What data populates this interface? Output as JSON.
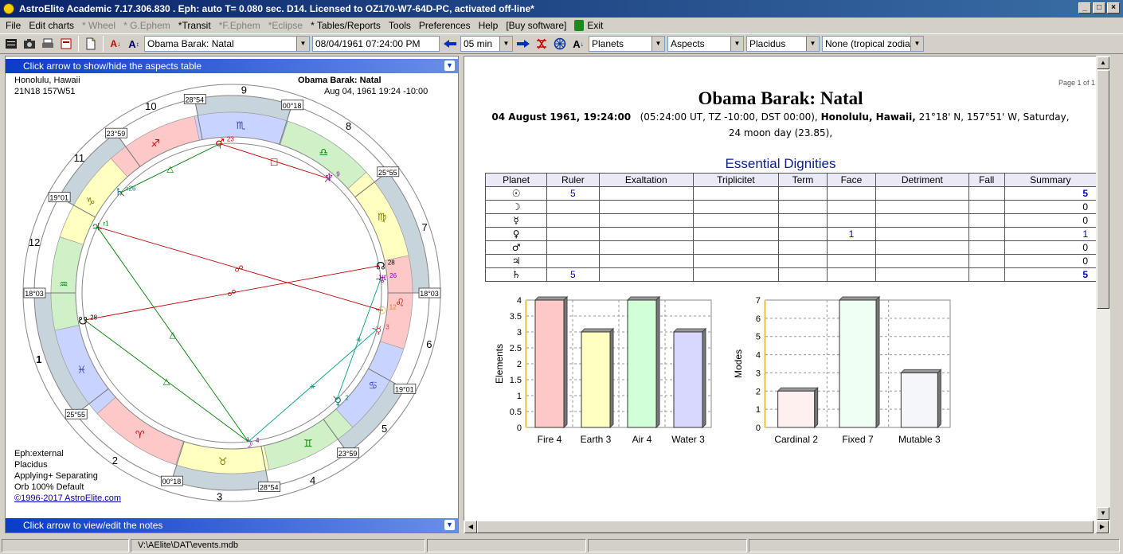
{
  "window": {
    "title": "AstroElite Academic 7.17.306.830 . Eph: auto T= 0.080 sec. D14. Licensed to OZ170-W7-64D-PC, activated off-line*",
    "buttons": [
      "_",
      "□",
      "×"
    ]
  },
  "menu": [
    {
      "label": "File",
      "disabled": false
    },
    {
      "label": "Edit charts",
      "disabled": false
    },
    {
      "label": "* Wheel",
      "disabled": true
    },
    {
      "label": "* G.Ephem",
      "disabled": true
    },
    {
      "label": "*Transit",
      "disabled": false
    },
    {
      "label": "*F.Ephem",
      "disabled": true
    },
    {
      "label": "*Eclipse",
      "disabled": true
    },
    {
      "label": "* Tables/Reports",
      "disabled": false
    },
    {
      "label": "Tools",
      "disabled": false
    },
    {
      "label": "Preferences",
      "disabled": false
    },
    {
      "label": "Help",
      "disabled": false
    },
    {
      "label": "[Buy software]",
      "disabled": false
    },
    {
      "label": "Exit",
      "disabled": false
    }
  ],
  "toolbar": {
    "chart_name": "Obama Barak: Natal",
    "datetime": "08/04/1961   07:24:00 PM",
    "step": "05 min",
    "planets": "Planets",
    "aspects": "Aspects",
    "house_system": "Placidus",
    "zodiac": "None (tropical zodiac)",
    "letter_a": "A",
    "arrow": "↓"
  },
  "left": {
    "top_bar": "Click arrow to show/hide the aspects table",
    "bottom_bar": "Click arrow to view/edit the notes",
    "location": "Honolulu, Hawaii",
    "coords": "21N18 157W51",
    "chart_title": "Obama Barak: Natal",
    "chart_date": "Aug 04, 1961 19:24 -10:00",
    "info": [
      "Eph:external",
      "Placidus",
      "Applying+ Separating",
      "Orb 100% Default"
    ],
    "copyright": "©1996-2017 AstroElite.com",
    "house_numbers": [
      "1",
      "2",
      "3",
      "4",
      "5",
      "6",
      "7",
      "8",
      "9",
      "10",
      "11",
      "12"
    ],
    "cusp_labels": [
      "18°03",
      "25°55",
      "00°18",
      "28°54",
      "23°59",
      "19°01",
      "18°03",
      "25°55",
      "00°18",
      "28°54",
      "23°59",
      "19°01"
    ],
    "signs": [
      "♓",
      "♈",
      "♉",
      "♊",
      "♋",
      "♌",
      "♍",
      "♎",
      "♏",
      "♐",
      "♑",
      "♒"
    ],
    "planets": [
      {
        "glyph": "♆",
        "deg": "9",
        "color": "#a000a0"
      },
      {
        "glyph": "♂",
        "deg": "23",
        "color": "#d00000"
      },
      {
        "glyph": "☊",
        "deg": "28",
        "color": "#000000"
      },
      {
        "glyph": "♅",
        "deg": "26",
        "color": "#a000a0"
      },
      {
        "glyph": "☉",
        "deg": "12",
        "color": "#e08000"
      },
      {
        "glyph": "☿",
        "deg": "3",
        "color": "#e04060"
      },
      {
        "glyph": "♀",
        "deg": "2",
        "color": "#008080"
      },
      {
        "glyph": "☽",
        "deg": "4",
        "color": "#8000a0"
      },
      {
        "glyph": "☋",
        "deg": "28",
        "color": "#000000"
      },
      {
        "glyph": "♃",
        "deg": "r1",
        "color": "#008000"
      },
      {
        "glyph": "♄",
        "deg": "r26",
        "color": "#008080"
      }
    ]
  },
  "report": {
    "page": "Page 1 of 1",
    "title": "Obama Barak: Natal",
    "date_bold": "04 August 1961, 19:24:00",
    "date_detail": "(05:24:00 UT, TZ -10:00, DST  00:00),",
    "place_bold": "Honolulu, Hawaii,",
    "place_detail": "21°18' N, 157°51' W, Saturday,",
    "moon_day": "24 moon day (23.85),",
    "section": "Essential Dignities",
    "columns": [
      "Planet",
      "Ruler",
      "Exaltation",
      "Triplicitet",
      "Term",
      "Face",
      "Detriment",
      "Fall",
      "Summary"
    ],
    "rows": [
      {
        "planet": "☉",
        "ruler": "5",
        "exaltation": "",
        "triplicitet": "",
        "term": "",
        "face": "",
        "detriment": "",
        "fall": "",
        "summary": "5",
        "bold": true
      },
      {
        "planet": "☽",
        "ruler": "",
        "exaltation": "",
        "triplicitet": "",
        "term": "",
        "face": "",
        "detriment": "",
        "fall": "",
        "summary": "0",
        "bold": false
      },
      {
        "planet": "☿",
        "ruler": "",
        "exaltation": "",
        "triplicitet": "",
        "term": "",
        "face": "",
        "detriment": "",
        "fall": "",
        "summary": "0",
        "bold": false
      },
      {
        "planet": "♀",
        "ruler": "",
        "exaltation": "",
        "triplicitet": "",
        "term": "",
        "face": "1",
        "detriment": "",
        "fall": "",
        "summary": "1",
        "bold": false
      },
      {
        "planet": "♂",
        "ruler": "",
        "exaltation": "",
        "triplicitet": "",
        "term": "",
        "face": "",
        "detriment": "",
        "fall": "",
        "summary": "0",
        "bold": false
      },
      {
        "planet": "♃",
        "ruler": "",
        "exaltation": "",
        "triplicitet": "",
        "term": "",
        "face": "",
        "detriment": "",
        "fall": "",
        "summary": "0",
        "bold": false
      },
      {
        "planet": "♄",
        "ruler": "5",
        "exaltation": "",
        "triplicitet": "",
        "term": "",
        "face": "",
        "detriment": "",
        "fall": "",
        "summary": "5",
        "bold": true
      }
    ]
  },
  "status": {
    "path": "V:\\AElite\\DAT\\events.mdb"
  },
  "chart_data": [
    {
      "type": "bar",
      "ylabel": "Elements",
      "categories": [
        "Fire 4",
        "Earth 3",
        "Air 4",
        "Water 3"
      ],
      "values": [
        4,
        3,
        4,
        3
      ],
      "colors": [
        "#ffc8c8",
        "#ffffc0",
        "#d0ffd8",
        "#d8d8ff"
      ],
      "ylim": [
        0,
        4
      ],
      "yticks": [
        "0",
        "0.5",
        "1",
        "1.5",
        "2",
        "2.5",
        "3",
        "3.5",
        "4"
      ],
      "grid": true
    },
    {
      "type": "bar",
      "ylabel": "Modes",
      "categories": [
        "Cardinal 2",
        "Fixed 7",
        "Mutable 3"
      ],
      "values": [
        2,
        7,
        3
      ],
      "colors": [
        "#fff0f0",
        "#f0fff4",
        "#f4f6fa"
      ],
      "ylim": [
        0,
        7
      ],
      "yticks": [
        "0",
        "1",
        "2",
        "3",
        "4",
        "5",
        "6",
        "7"
      ],
      "grid": true
    }
  ]
}
